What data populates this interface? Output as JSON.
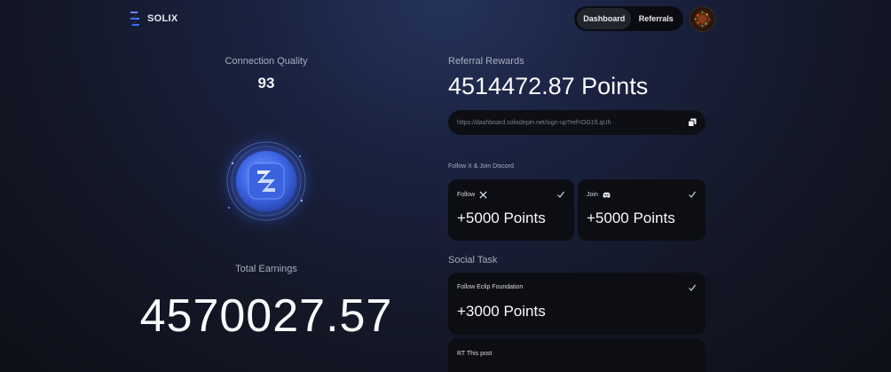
{
  "header": {
    "brand": "SOLIX",
    "nav": [
      {
        "label": "Dashboard",
        "active": true
      },
      {
        "label": "Referrals",
        "active": false
      }
    ]
  },
  "left": {
    "connection_quality_label": "Connection Quality",
    "connection_quality_value": "93",
    "total_earnings_label": "Total Earnings",
    "total_earnings_value": "4570027.57"
  },
  "right": {
    "referral_rewards_label": "Referral Rewards",
    "referral_rewards_value": "4514472.87 Points",
    "referral_link": "https://dashboard.solixdepin.net/sign-up?ref=OG1fLqUh",
    "follow_section_label": "Follow X & Join Discord",
    "follow_tasks": [
      {
        "label": "Follow",
        "icon": "x-logo-icon",
        "points": "+5000 Points"
      },
      {
        "label": "Join",
        "icon": "discord-icon",
        "points": "+5000 Points"
      }
    ],
    "social_task_label": "Social Task",
    "social_tasks": [
      {
        "label": "Follow Eclip Foundation",
        "points": "+3000 Points"
      },
      {
        "label": "RT This post"
      }
    ]
  },
  "colors": {
    "accent_blue": "#3d6bff",
    "card_bg": "#0d0e13",
    "muted_text": "#a7adbd"
  }
}
